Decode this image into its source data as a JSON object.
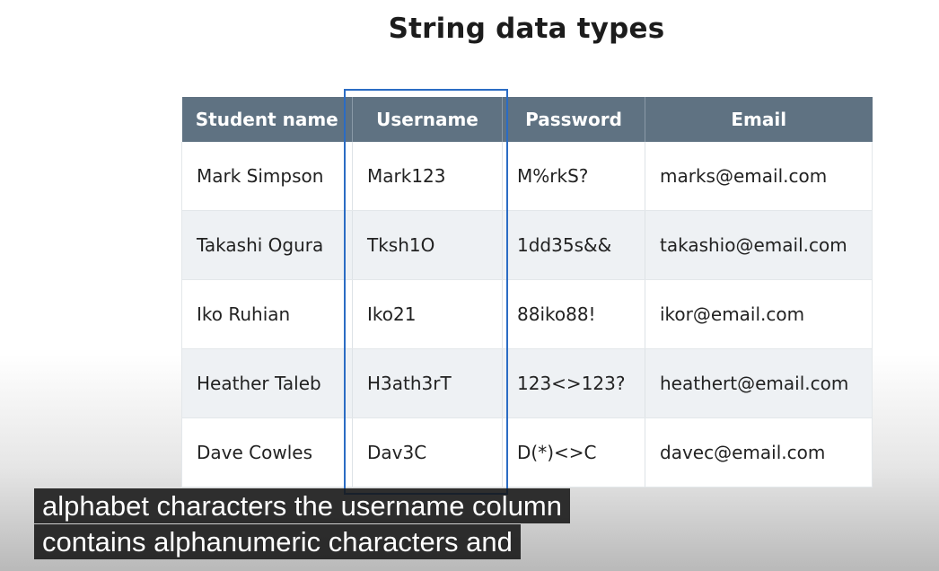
{
  "slide": {
    "title": "String data types"
  },
  "table": {
    "headers": [
      "Student name",
      "Username",
      "Password",
      "Email"
    ],
    "rows": [
      [
        "Mark Simpson",
        "Mark123",
        "M%rkS?",
        "marks@email.com"
      ],
      [
        "Takashi Ogura",
        "Tksh1O",
        "1dd35s&&",
        "takashio@email.com"
      ],
      [
        "Iko Ruhian",
        "Iko21",
        "88iko88!",
        "ikor@email.com"
      ],
      [
        "Heather Taleb",
        "H3ath3rT",
        "123<>123?",
        "heathert@email.com"
      ],
      [
        "Dave Cowles",
        "Dav3C",
        "D(*)<>C",
        "davec@email.com"
      ]
    ]
  },
  "captions": {
    "line1": "alphabet characters the username column",
    "line2": "contains alphanumeric characters and"
  },
  "colors": {
    "header_bg": "#5f7282",
    "highlight_border": "#2b6cc4",
    "row_alt_bg": "#eef1f4",
    "caption_bg": "#161616"
  }
}
